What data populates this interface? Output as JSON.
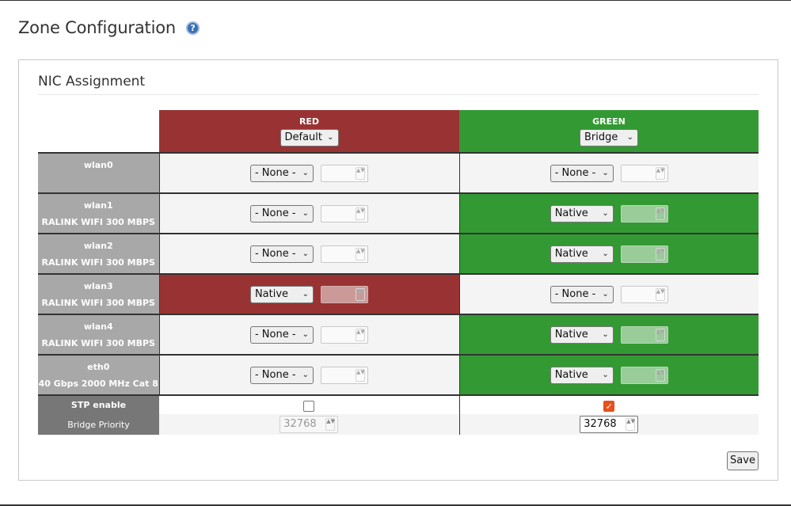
{
  "page": {
    "title": "Zone Configuration",
    "help_icon": "?"
  },
  "panel": {
    "title": "NIC Assignment"
  },
  "zones": [
    {
      "name": "RED",
      "mode": "Default",
      "color": "#993333"
    },
    {
      "name": "GREEN",
      "mode": "Bridge",
      "color": "#339933"
    }
  ],
  "nics": [
    {
      "name": "wlan0",
      "desc": "",
      "red": "- None -",
      "green": "- None -"
    },
    {
      "name": "wlan1",
      "desc": "RALINK WIFI 300 MBPS",
      "red": "- None -",
      "green": "Native"
    },
    {
      "name": "wlan2",
      "desc": "RALINK WIFI 300 MBPS",
      "red": "- None -",
      "green": "Native"
    },
    {
      "name": "wlan3",
      "desc": "RALINK WIFI 300 MBPS",
      "red": "Native",
      "green": "- None -"
    },
    {
      "name": "wlan4",
      "desc": "RALINK WIFI 300 MBPS",
      "red": "- None -",
      "green": "Native"
    },
    {
      "name": "eth0",
      "desc": "40 Gbps 2000 MHz Cat 8",
      "red": "- None -",
      "green": "Native"
    }
  ],
  "stp": {
    "label": "STP enable",
    "red_checked": false,
    "green_checked": true,
    "check_mark": "✓"
  },
  "bridge_priority": {
    "label": "Bridge Priority",
    "red_value": "32768",
    "green_value": "32768"
  },
  "actions": {
    "save_label": "Save"
  },
  "glyphs": {
    "chevron": "⌄",
    "spin": "▲▼"
  }
}
